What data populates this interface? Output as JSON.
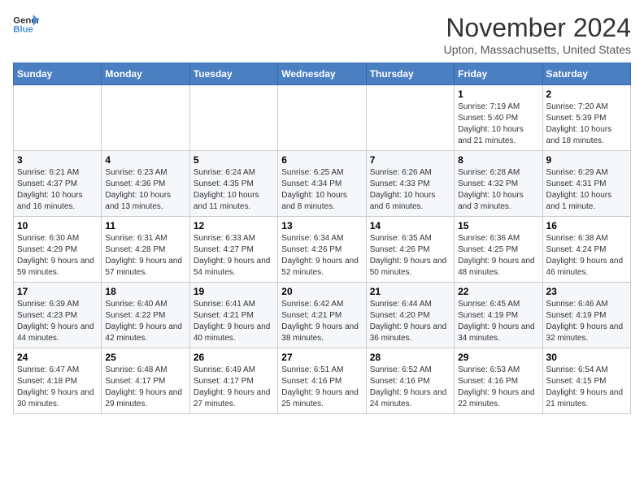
{
  "logo": {
    "line1": "General",
    "line2": "Blue"
  },
  "title": "November 2024",
  "location": "Upton, Massachusetts, United States",
  "days_of_week": [
    "Sunday",
    "Monday",
    "Tuesday",
    "Wednesday",
    "Thursday",
    "Friday",
    "Saturday"
  ],
  "weeks": [
    [
      {
        "day": "",
        "info": ""
      },
      {
        "day": "",
        "info": ""
      },
      {
        "day": "",
        "info": ""
      },
      {
        "day": "",
        "info": ""
      },
      {
        "day": "",
        "info": ""
      },
      {
        "day": "1",
        "info": "Sunrise: 7:19 AM\nSunset: 5:40 PM\nDaylight: 10 hours and 21 minutes."
      },
      {
        "day": "2",
        "info": "Sunrise: 7:20 AM\nSunset: 5:39 PM\nDaylight: 10 hours and 18 minutes."
      }
    ],
    [
      {
        "day": "3",
        "info": "Sunrise: 6:21 AM\nSunset: 4:37 PM\nDaylight: 10 hours and 16 minutes."
      },
      {
        "day": "4",
        "info": "Sunrise: 6:23 AM\nSunset: 4:36 PM\nDaylight: 10 hours and 13 minutes."
      },
      {
        "day": "5",
        "info": "Sunrise: 6:24 AM\nSunset: 4:35 PM\nDaylight: 10 hours and 11 minutes."
      },
      {
        "day": "6",
        "info": "Sunrise: 6:25 AM\nSunset: 4:34 PM\nDaylight: 10 hours and 8 minutes."
      },
      {
        "day": "7",
        "info": "Sunrise: 6:26 AM\nSunset: 4:33 PM\nDaylight: 10 hours and 6 minutes."
      },
      {
        "day": "8",
        "info": "Sunrise: 6:28 AM\nSunset: 4:32 PM\nDaylight: 10 hours and 3 minutes."
      },
      {
        "day": "9",
        "info": "Sunrise: 6:29 AM\nSunset: 4:31 PM\nDaylight: 10 hours and 1 minute."
      }
    ],
    [
      {
        "day": "10",
        "info": "Sunrise: 6:30 AM\nSunset: 4:29 PM\nDaylight: 9 hours and 59 minutes."
      },
      {
        "day": "11",
        "info": "Sunrise: 6:31 AM\nSunset: 4:28 PM\nDaylight: 9 hours and 57 minutes."
      },
      {
        "day": "12",
        "info": "Sunrise: 6:33 AM\nSunset: 4:27 PM\nDaylight: 9 hours and 54 minutes."
      },
      {
        "day": "13",
        "info": "Sunrise: 6:34 AM\nSunset: 4:26 PM\nDaylight: 9 hours and 52 minutes."
      },
      {
        "day": "14",
        "info": "Sunrise: 6:35 AM\nSunset: 4:26 PM\nDaylight: 9 hours and 50 minutes."
      },
      {
        "day": "15",
        "info": "Sunrise: 6:36 AM\nSunset: 4:25 PM\nDaylight: 9 hours and 48 minutes."
      },
      {
        "day": "16",
        "info": "Sunrise: 6:38 AM\nSunset: 4:24 PM\nDaylight: 9 hours and 46 minutes."
      }
    ],
    [
      {
        "day": "17",
        "info": "Sunrise: 6:39 AM\nSunset: 4:23 PM\nDaylight: 9 hours and 44 minutes."
      },
      {
        "day": "18",
        "info": "Sunrise: 6:40 AM\nSunset: 4:22 PM\nDaylight: 9 hours and 42 minutes."
      },
      {
        "day": "19",
        "info": "Sunrise: 6:41 AM\nSunset: 4:21 PM\nDaylight: 9 hours and 40 minutes."
      },
      {
        "day": "20",
        "info": "Sunrise: 6:42 AM\nSunset: 4:21 PM\nDaylight: 9 hours and 38 minutes."
      },
      {
        "day": "21",
        "info": "Sunrise: 6:44 AM\nSunset: 4:20 PM\nDaylight: 9 hours and 36 minutes."
      },
      {
        "day": "22",
        "info": "Sunrise: 6:45 AM\nSunset: 4:19 PM\nDaylight: 9 hours and 34 minutes."
      },
      {
        "day": "23",
        "info": "Sunrise: 6:46 AM\nSunset: 4:19 PM\nDaylight: 9 hours and 32 minutes."
      }
    ],
    [
      {
        "day": "24",
        "info": "Sunrise: 6:47 AM\nSunset: 4:18 PM\nDaylight: 9 hours and 30 minutes."
      },
      {
        "day": "25",
        "info": "Sunrise: 6:48 AM\nSunset: 4:17 PM\nDaylight: 9 hours and 29 minutes."
      },
      {
        "day": "26",
        "info": "Sunrise: 6:49 AM\nSunset: 4:17 PM\nDaylight: 9 hours and 27 minutes."
      },
      {
        "day": "27",
        "info": "Sunrise: 6:51 AM\nSunset: 4:16 PM\nDaylight: 9 hours and 25 minutes."
      },
      {
        "day": "28",
        "info": "Sunrise: 6:52 AM\nSunset: 4:16 PM\nDaylight: 9 hours and 24 minutes."
      },
      {
        "day": "29",
        "info": "Sunrise: 6:53 AM\nSunset: 4:16 PM\nDaylight: 9 hours and 22 minutes."
      },
      {
        "day": "30",
        "info": "Sunrise: 6:54 AM\nSunset: 4:15 PM\nDaylight: 9 hours and 21 minutes."
      }
    ]
  ]
}
